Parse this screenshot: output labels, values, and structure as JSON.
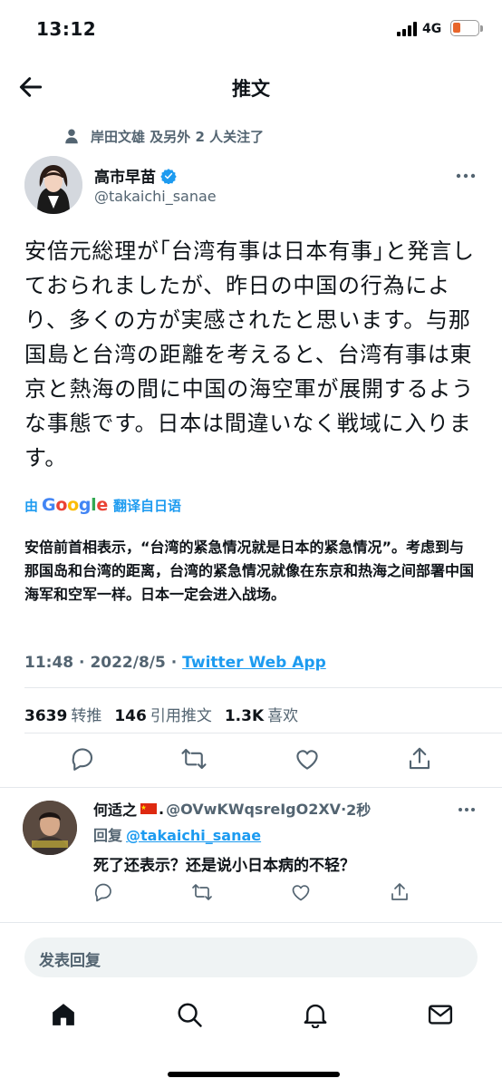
{
  "status_bar": {
    "time": "13:12",
    "network": "4G",
    "battery_color": "#e8662b"
  },
  "header": {
    "title": "推文",
    "back_icon": "arrow-left-icon"
  },
  "social_context": {
    "text": "岸田文雄 及另外 2 人关注了",
    "icon": "person-icon"
  },
  "tweet": {
    "author_name": "高市早苗",
    "author_handle": "@takaichi_sanae",
    "verified": true,
    "text": "安倍元総理が｢台湾有事は日本有事｣と発言しておられましたが、昨日の中国の行為により、多くの方が実感されたと思います。与那国島と台湾の距離を考えると、台湾有事は東京と熱海の間に中国の海空軍が展開するような事態です。日本は間違いなく戦域に入ります。",
    "translate": {
      "by": "由",
      "provider": "Google",
      "label": "翻译自日语"
    },
    "translation": "安倍前首相表示，“台湾的紧急情况就是日本的紧急情况”。考虑到与那国岛和台湾的距离，台湾的紧急情况就像在东京和热海之间部署中国海军和空军一样。日本一定会进入战场。",
    "time": "11:48",
    "separator": "·",
    "date": "2022/8/5",
    "source": "Twitter Web App",
    "stats": [
      {
        "value": "3639",
        "label": "转推"
      },
      {
        "value": "146",
        "label": "引用推文"
      },
      {
        "value": "1.3K",
        "label": "喜欢"
      }
    ],
    "actions": [
      "reply-icon",
      "retweet-icon",
      "like-icon",
      "share-icon"
    ]
  },
  "reply": {
    "name": "何适之",
    "flag": "china-flag",
    "dot": ".",
    "handle": "@OVwKWqsreIgO2XV",
    "separator": "·",
    "time": "2秒",
    "reply_to_label": "回复",
    "reply_to_handle": "@takaichi_sanae",
    "text": "死了还表示？还是说小日本病的不轻？"
  },
  "compose": {
    "placeholder": "发表回复"
  },
  "tab_bar": [
    "home-icon",
    "search-icon",
    "notifications-icon",
    "messages-icon"
  ],
  "colors": {
    "accent": "#1d9bf0",
    "secondary_text": "#536471",
    "primary_text": "#0f1419"
  }
}
